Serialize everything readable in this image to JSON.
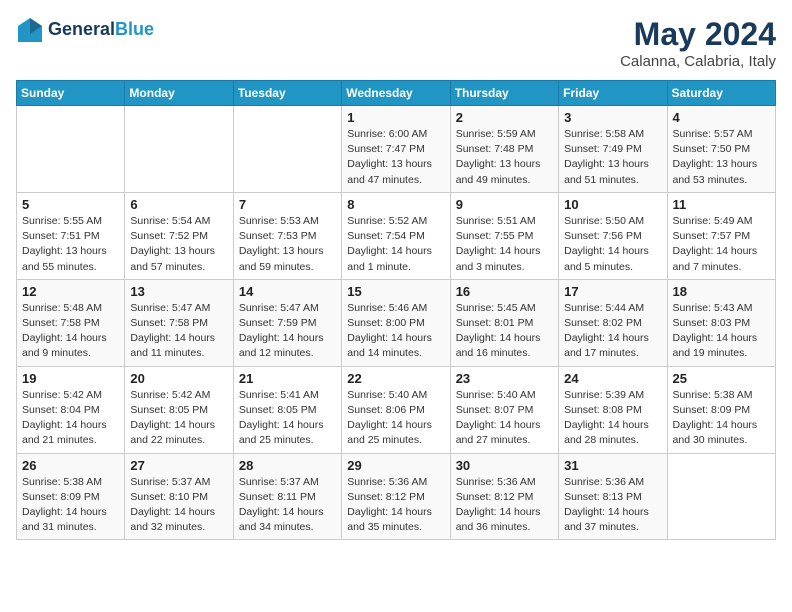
{
  "header": {
    "logo_line1": "General",
    "logo_line2": "Blue",
    "month": "May 2024",
    "location": "Calanna, Calabria, Italy"
  },
  "weekdays": [
    "Sunday",
    "Monday",
    "Tuesday",
    "Wednesday",
    "Thursday",
    "Friday",
    "Saturday"
  ],
  "weeks": [
    [
      {
        "day": "",
        "info": ""
      },
      {
        "day": "",
        "info": ""
      },
      {
        "day": "",
        "info": ""
      },
      {
        "day": "1",
        "info": "Sunrise: 6:00 AM\nSunset: 7:47 PM\nDaylight: 13 hours\nand 47 minutes."
      },
      {
        "day": "2",
        "info": "Sunrise: 5:59 AM\nSunset: 7:48 PM\nDaylight: 13 hours\nand 49 minutes."
      },
      {
        "day": "3",
        "info": "Sunrise: 5:58 AM\nSunset: 7:49 PM\nDaylight: 13 hours\nand 51 minutes."
      },
      {
        "day": "4",
        "info": "Sunrise: 5:57 AM\nSunset: 7:50 PM\nDaylight: 13 hours\nand 53 minutes."
      }
    ],
    [
      {
        "day": "5",
        "info": "Sunrise: 5:55 AM\nSunset: 7:51 PM\nDaylight: 13 hours\nand 55 minutes."
      },
      {
        "day": "6",
        "info": "Sunrise: 5:54 AM\nSunset: 7:52 PM\nDaylight: 13 hours\nand 57 minutes."
      },
      {
        "day": "7",
        "info": "Sunrise: 5:53 AM\nSunset: 7:53 PM\nDaylight: 13 hours\nand 59 minutes."
      },
      {
        "day": "8",
        "info": "Sunrise: 5:52 AM\nSunset: 7:54 PM\nDaylight: 14 hours\nand 1 minute."
      },
      {
        "day": "9",
        "info": "Sunrise: 5:51 AM\nSunset: 7:55 PM\nDaylight: 14 hours\nand 3 minutes."
      },
      {
        "day": "10",
        "info": "Sunrise: 5:50 AM\nSunset: 7:56 PM\nDaylight: 14 hours\nand 5 minutes."
      },
      {
        "day": "11",
        "info": "Sunrise: 5:49 AM\nSunset: 7:57 PM\nDaylight: 14 hours\nand 7 minutes."
      }
    ],
    [
      {
        "day": "12",
        "info": "Sunrise: 5:48 AM\nSunset: 7:58 PM\nDaylight: 14 hours\nand 9 minutes."
      },
      {
        "day": "13",
        "info": "Sunrise: 5:47 AM\nSunset: 7:58 PM\nDaylight: 14 hours\nand 11 minutes."
      },
      {
        "day": "14",
        "info": "Sunrise: 5:47 AM\nSunset: 7:59 PM\nDaylight: 14 hours\nand 12 minutes."
      },
      {
        "day": "15",
        "info": "Sunrise: 5:46 AM\nSunset: 8:00 PM\nDaylight: 14 hours\nand 14 minutes."
      },
      {
        "day": "16",
        "info": "Sunrise: 5:45 AM\nSunset: 8:01 PM\nDaylight: 14 hours\nand 16 minutes."
      },
      {
        "day": "17",
        "info": "Sunrise: 5:44 AM\nSunset: 8:02 PM\nDaylight: 14 hours\nand 17 minutes."
      },
      {
        "day": "18",
        "info": "Sunrise: 5:43 AM\nSunset: 8:03 PM\nDaylight: 14 hours\nand 19 minutes."
      }
    ],
    [
      {
        "day": "19",
        "info": "Sunrise: 5:42 AM\nSunset: 8:04 PM\nDaylight: 14 hours\nand 21 minutes."
      },
      {
        "day": "20",
        "info": "Sunrise: 5:42 AM\nSunset: 8:05 PM\nDaylight: 14 hours\nand 22 minutes."
      },
      {
        "day": "21",
        "info": "Sunrise: 5:41 AM\nSunset: 8:05 PM\nDaylight: 14 hours\nand 25 minutes."
      },
      {
        "day": "22",
        "info": "Sunrise: 5:40 AM\nSunset: 8:06 PM\nDaylight: 14 hours\nand 25 minutes."
      },
      {
        "day": "23",
        "info": "Sunrise: 5:40 AM\nSunset: 8:07 PM\nDaylight: 14 hours\nand 27 minutes."
      },
      {
        "day": "24",
        "info": "Sunrise: 5:39 AM\nSunset: 8:08 PM\nDaylight: 14 hours\nand 28 minutes."
      },
      {
        "day": "25",
        "info": "Sunrise: 5:38 AM\nSunset: 8:09 PM\nDaylight: 14 hours\nand 30 minutes."
      }
    ],
    [
      {
        "day": "26",
        "info": "Sunrise: 5:38 AM\nSunset: 8:09 PM\nDaylight: 14 hours\nand 31 minutes."
      },
      {
        "day": "27",
        "info": "Sunrise: 5:37 AM\nSunset: 8:10 PM\nDaylight: 14 hours\nand 32 minutes."
      },
      {
        "day": "28",
        "info": "Sunrise: 5:37 AM\nSunset: 8:11 PM\nDaylight: 14 hours\nand 34 minutes."
      },
      {
        "day": "29",
        "info": "Sunrise: 5:36 AM\nSunset: 8:12 PM\nDaylight: 14 hours\nand 35 minutes."
      },
      {
        "day": "30",
        "info": "Sunrise: 5:36 AM\nSunset: 8:12 PM\nDaylight: 14 hours\nand 36 minutes."
      },
      {
        "day": "31",
        "info": "Sunrise: 5:36 AM\nSunset: 8:13 PM\nDaylight: 14 hours\nand 37 minutes."
      },
      {
        "day": "",
        "info": ""
      }
    ]
  ]
}
